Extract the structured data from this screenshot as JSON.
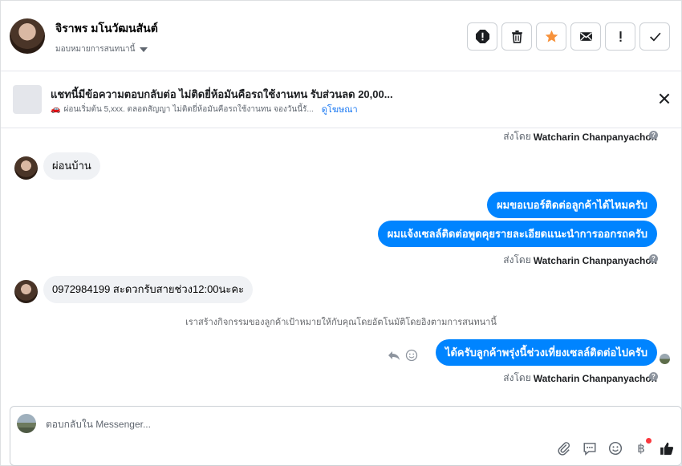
{
  "header": {
    "contact_name": "จิราพร มโนวัฒนสันต์",
    "assign_label": "มอบหมายการสนทนานี้",
    "tools": [
      {
        "icon": "report-icon"
      },
      {
        "icon": "trash-icon"
      },
      {
        "icon": "star-icon"
      },
      {
        "icon": "mail-icon"
      },
      {
        "icon": "exclamation-icon"
      },
      {
        "icon": "check-icon"
      }
    ]
  },
  "ad": {
    "title": "แชทนี้มีข้อความตอบกลับต่อ ไม่ติดยี่ห้อมันคือรถใช้งานทน รับส่วนลด 20,00...",
    "subtitle": "ผ่อนเริ่มต้น 5,xxx. ตลอดสัญญา ไม่ติดยี่ห้อมันคือรถใช้งานทน จองวันนี้รั...",
    "link": "ดูโฆษณา"
  },
  "messages": {
    "sent_by_prefix": "ส่งโดย",
    "sender_name": "Watcharin Chanpanyachon",
    "incoming_1": "ผ่อนบ้าน",
    "outgoing_1": "ผมขอเบอร์ติดต่อลูกค้าได้ไหมครับ",
    "outgoing_2": "ผมแจ้งเซลล์ติดต่อพูดคุยรายละเอียดแนะนำการออกรถครับ",
    "incoming_2": "0972984199 สะดวกรับสายช่วง12:00นะคะ",
    "system_note": "เราสร้างกิจกรรมของลูกค้าเป้าหมายให้กับคุณโดยอัตโนมัติโดยอิงตามการสนทนานี้",
    "outgoing_3": "ได้ครับลูกค้าพรุ่งนี้ช่วงเที่ยงเซลล์ติดต่อไปครับ"
  },
  "composer": {
    "placeholder": "ตอบกลับใน Messenger...",
    "tools": [
      "attach-icon",
      "saved-reply-icon",
      "emoji-icon",
      "baht-payment-icon",
      "like-icon"
    ]
  },
  "colors": {
    "accent": "#0084ff",
    "star": "#f7923b",
    "link": "#1877f2"
  }
}
